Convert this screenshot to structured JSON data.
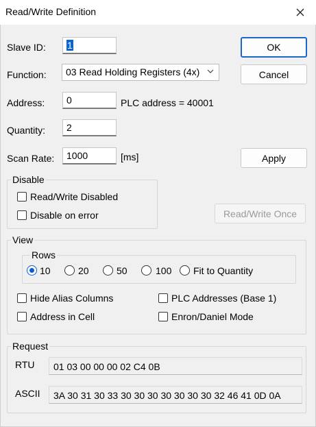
{
  "window": {
    "title": "Read/Write Definition"
  },
  "fields": {
    "slave_id_label": "Slave ID:",
    "slave_id_value": "1",
    "function_label": "Function:",
    "function_value": "03 Read Holding Registers (4x)",
    "address_label": "Address:",
    "address_value": "0",
    "plc_address_text": "PLC address = 40001",
    "quantity_label": "Quantity:",
    "quantity_value": "2",
    "scan_rate_label": "Scan Rate:",
    "scan_rate_value": "1000",
    "scan_rate_unit": "[ms]"
  },
  "buttons": {
    "ok": "OK",
    "cancel": "Cancel",
    "apply": "Apply",
    "read_write_once": "Read/Write Once"
  },
  "disable_group": {
    "title": "Disable",
    "read_write_disabled": "Read/Write Disabled",
    "disable_on_error": "Disable on error"
  },
  "view_group": {
    "title": "View",
    "rows_title": "Rows",
    "rows_options": [
      "10",
      "20",
      "50",
      "100",
      "Fit to Quantity"
    ],
    "rows_selected": "10",
    "hide_alias_columns": "Hide Alias Columns",
    "address_in_cell": "Address in Cell",
    "plc_addresses_base1": "PLC Addresses (Base 1)",
    "enron_daniel_mode": "Enron/Daniel Mode"
  },
  "request_group": {
    "title": "Request",
    "rtu_label": "RTU",
    "rtu_value": "01 03 00 00 00 02 C4 0B",
    "ascii_label": "ASCII",
    "ascii_value": "3A 30 31 30 33 30 30 30 30 30 30 30 32 46 41 0D 0A"
  },
  "icons": {
    "close": "close-icon",
    "dropdown": "chevron-down-icon"
  }
}
